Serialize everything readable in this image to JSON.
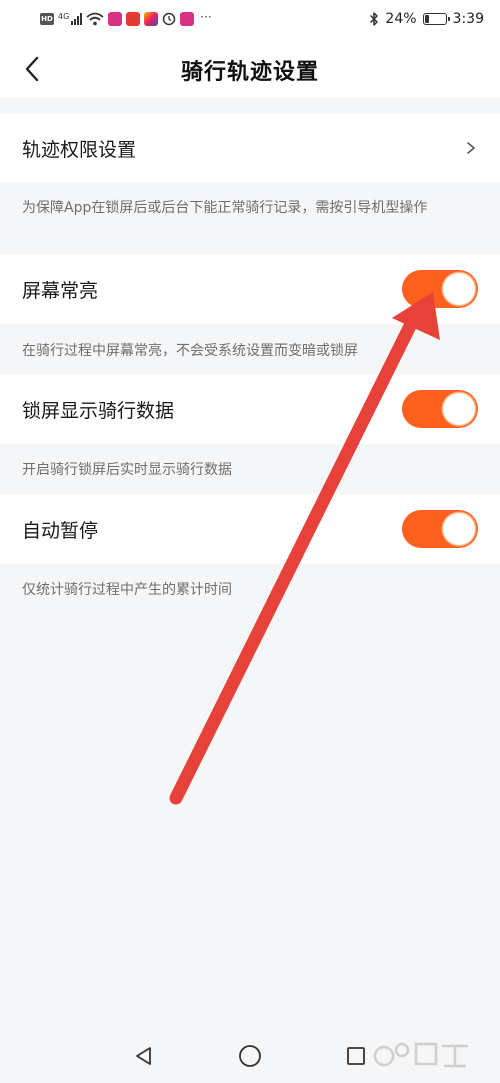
{
  "status_bar": {
    "left_badge": "HD",
    "network": "4G",
    "dots": "···",
    "battery_text": "24%",
    "battery_level": 0.24,
    "time": "3:39"
  },
  "header": {
    "title": "骑行轨迹设置"
  },
  "settings": {
    "track_permission": {
      "label": "轨迹权限设置"
    },
    "track_permission_note": "为保障App在锁屏后或后台下能正常骑行记录，需按引导机型操作",
    "screen_on": {
      "label": "屏幕常亮",
      "enabled": true
    },
    "screen_on_note": "在骑行过程中屏幕常亮，不会受系统设置而变暗或锁屏",
    "lockscreen_data": {
      "label": "锁屏显示骑行数据",
      "enabled": true
    },
    "lockscreen_data_note": "开启骑行锁屏后实时显示骑行数据",
    "auto_pause": {
      "label": "自动暂停",
      "enabled": true
    },
    "auto_pause_note": "仅统计骑行过程中产生的累计时间"
  },
  "colors": {
    "toggle_on": "#fd5f1e",
    "toggle_off": "#d8d8d8",
    "knob_ring": "#f9b07f",
    "arrow": "#e6423a",
    "watermark": "#cfcfcf"
  }
}
